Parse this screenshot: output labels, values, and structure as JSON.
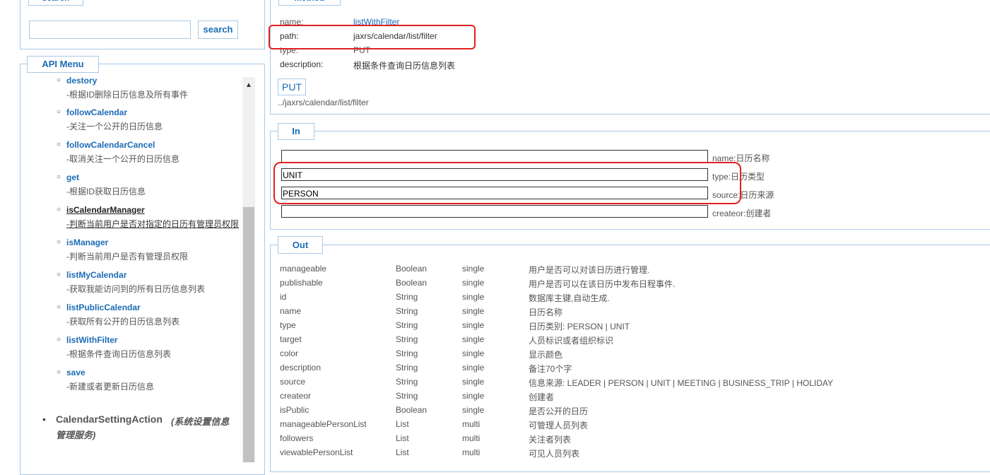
{
  "search": {
    "legend": "search",
    "input_value": "",
    "button_label": "search"
  },
  "api_menu": {
    "legend": "API Menu",
    "items": [
      {
        "name": "destory",
        "desc": "-根据ID删除日历信息及所有事件"
      },
      {
        "name": "followCalendar",
        "desc": "-关注一个公开的日历信息"
      },
      {
        "name": "followCalendarCancel",
        "desc": "-取消关注一个公开的日历信息"
      },
      {
        "name": "get",
        "desc": "-根据ID获取日历信息"
      },
      {
        "name": "isCalendarManager",
        "desc": "-判断当前用户是否对指定的日历有管理员权限"
      },
      {
        "name": "isManager",
        "desc": "-判断当前用户是否有管理员权限"
      },
      {
        "name": "listMyCalendar",
        "desc": "-获取我能访问到的所有日历信息列表"
      },
      {
        "name": "listPublicCalendar",
        "desc": "-获取所有公开的日历信息列表"
      },
      {
        "name": "listWithFilter",
        "desc": "-根据条件查询日历信息列表"
      },
      {
        "name": "save",
        "desc": "-新建或者更新日历信息"
      }
    ],
    "group": {
      "name": "CalendarSettingAction",
      "desc_line1": "(系统设置信息",
      "desc_line2": "管理服务)"
    },
    "scroll_up": "▲"
  },
  "method": {
    "legend": "Method",
    "rows": [
      {
        "key": "name:",
        "value": "listWithFilter"
      },
      {
        "key": "path:",
        "value": "jaxrs/calendar/list/filter"
      },
      {
        "key": "type:",
        "value": "PUT"
      },
      {
        "key": "description:",
        "value": "根据条件查询日历信息列表"
      }
    ],
    "verb_button": "PUT",
    "url": "../jaxrs/calendar/list/filter"
  },
  "in": {
    "legend": "In",
    "fields": [
      {
        "value": "",
        "label": "name:日历名称"
      },
      {
        "value": "UNIT",
        "label": "type:日历类型"
      },
      {
        "value": "PERSON",
        "label": "source:日历来源"
      },
      {
        "value": "",
        "label": "createor:创建者"
      }
    ]
  },
  "out": {
    "legend": "Out",
    "rows": [
      [
        "manageable",
        "Boolean",
        "single",
        "用户是否可以对该日历进行管理."
      ],
      [
        "publishable",
        "Boolean",
        "single",
        "用户是否可以在该日历中发布日程事件."
      ],
      [
        "id",
        "String",
        "single",
        "数据库主键,自动生成."
      ],
      [
        "name",
        "String",
        "single",
        "日历名称"
      ],
      [
        "type",
        "String",
        "single",
        "日历类别: PERSON | UNIT"
      ],
      [
        "target",
        "String",
        "single",
        "人员标识或者组织标识"
      ],
      [
        "color",
        "String",
        "single",
        "显示颜色"
      ],
      [
        "description",
        "String",
        "single",
        "备注70个字"
      ],
      [
        "source",
        "String",
        "single",
        "信息来源: LEADER | PERSON | UNIT | MEETING | BUSINESS_TRIP | HOLIDAY"
      ],
      [
        "createor",
        "String",
        "single",
        "创建者"
      ],
      [
        "isPublic",
        "Boolean",
        "single",
        "是否公开的日历"
      ],
      [
        "manageablePersonList",
        "List",
        "multi",
        "可管理人员列表"
      ],
      [
        "followers",
        "List",
        "multi",
        "关注者列表"
      ],
      [
        "viewablePersonList",
        "List",
        "multi",
        "可见人员列表"
      ]
    ]
  },
  "colors": {
    "accent": "#1c6bb5",
    "border": "#a9c8e6",
    "highlight": "#e02020"
  }
}
